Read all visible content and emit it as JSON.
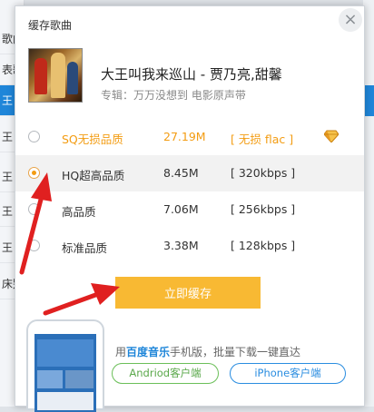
{
  "background": {
    "left_cells": [
      "歌曲",
      "表歌",
      "王",
      "王",
      "王",
      "王",
      "王",
      "床别"
    ]
  },
  "dialog": {
    "title": "缓存歌曲",
    "close_glyph": "×"
  },
  "song": {
    "title": "大王叫我来巡山 - 贾乃亮,甜馨",
    "album": "专辑：万万没想到 电影原声带"
  },
  "options": [
    {
      "name": "SQ无损品质",
      "size": "27.19M",
      "format": "[ 无损 flac ]",
      "selected": false,
      "vip": true
    },
    {
      "name": "HQ超高品质",
      "size": "8.45M",
      "format": "[ 320kbps ]",
      "selected": true,
      "vip": false
    },
    {
      "name": "高品质",
      "size": "7.06M",
      "format": "[ 256kbps ]",
      "selected": false,
      "vip": false
    },
    {
      "name": "标准品质",
      "size": "3.38M",
      "format": "[ 128kbps ]",
      "selected": false,
      "vip": false
    }
  ],
  "download_label": "立即缓存",
  "promo": {
    "prefix": "用",
    "brand": "百度音乐",
    "suffix": "手机版，批量下载一键直达",
    "android_label": "Andriod客户端",
    "iphone_label": "iPhone客户端"
  },
  "colors": {
    "accent_orange": "#f8b933",
    "sq_text": "#f39c12",
    "arrow_red": "#e02020",
    "android_green": "#5aa84a",
    "iphone_blue": "#2a8de0"
  }
}
